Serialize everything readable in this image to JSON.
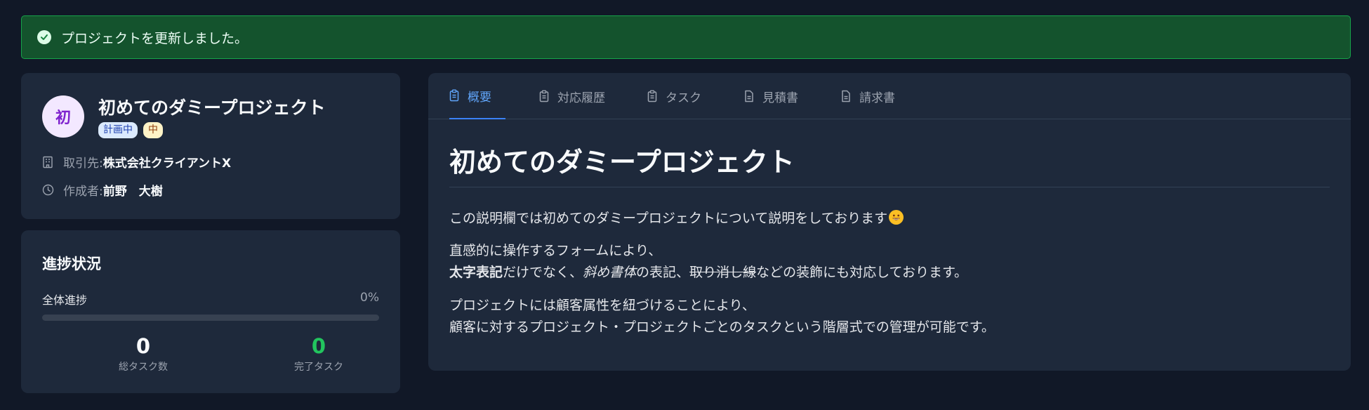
{
  "banner": {
    "message": "プロジェクトを更新しました。"
  },
  "project": {
    "avatar_char": "初",
    "title": "初めてのダミープロジェクト",
    "status_badge": "計画中",
    "priority_badge": "中",
    "client_label": "取引先:",
    "client_value": "株式会社クライアントX",
    "author_label": "作成者:",
    "author_value": "前野　大樹"
  },
  "progress": {
    "title": "進捗状況",
    "overall_label": "全体進捗",
    "overall_percent_text": "0%",
    "overall_fraction": 0,
    "total_tasks_value": "0",
    "total_tasks_label": "総タスク数",
    "done_tasks_value": "0",
    "done_tasks_label": "完了タスク"
  },
  "tabs": [
    {
      "label": "概要",
      "active": true
    },
    {
      "label": "対応履歴",
      "active": false
    },
    {
      "label": "タスク",
      "active": false
    },
    {
      "label": "見積書",
      "active": false
    },
    {
      "label": "請求書",
      "active": false
    }
  ],
  "content": {
    "title": "初めてのダミープロジェクト",
    "p1": "この説明欄では初めてのダミープロジェクトについて説明をしております",
    "p2_line1": "直感的に操作するフォームにより、",
    "p2_bold": "太字表記",
    "p2_mid1": "だけでなく、",
    "p2_italic": "斜め書体",
    "p2_mid2": "の表記、",
    "p2_strike": "取り消し線",
    "p2_end": "などの装飾にも対応しております。",
    "p3_line1": "プロジェクトには顧客属性を紐づけることにより、",
    "p3_line2": "顧客に対するプロジェクト・プロジェクトごとのタスクという階層式での管理が可能です。"
  },
  "colors": {
    "accent": "#3b82f6",
    "success": "#22c55e",
    "banner_bg": "#14532d"
  },
  "icons": {
    "banner": "check-circle-icon",
    "client": "building-icon",
    "author": "clock-icon",
    "tab_overview": "clipboard-icon",
    "tab_history": "clipboard-icon",
    "tab_tasks": "clipboard-icon",
    "tab_estimate": "document-icon",
    "tab_invoice": "document-icon",
    "emoji": "grinning-face-icon"
  }
}
